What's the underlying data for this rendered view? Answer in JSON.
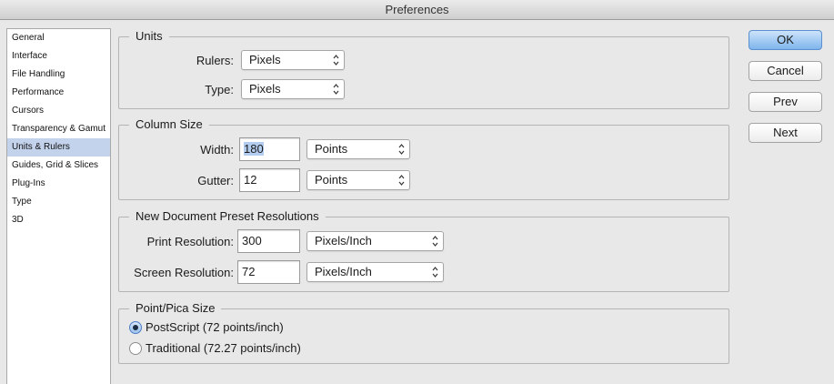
{
  "window": {
    "title": "Preferences"
  },
  "sidebar": {
    "items": [
      {
        "label": "General"
      },
      {
        "label": "Interface"
      },
      {
        "label": "File Handling"
      },
      {
        "label": "Performance"
      },
      {
        "label": "Cursors"
      },
      {
        "label": "Transparency & Gamut"
      },
      {
        "label": "Units & Rulers",
        "selected": true
      },
      {
        "label": "Guides, Grid & Slices"
      },
      {
        "label": "Plug-Ins"
      },
      {
        "label": "Type"
      },
      {
        "label": "3D"
      }
    ]
  },
  "units": {
    "legend": "Units",
    "rulers_label": "Rulers:",
    "rulers_value": "Pixels",
    "type_label": "Type:",
    "type_value": "Pixels"
  },
  "column_size": {
    "legend": "Column Size",
    "width_label": "Width:",
    "width_value": "180",
    "width_unit": "Points",
    "gutter_label": "Gutter:",
    "gutter_value": "12",
    "gutter_unit": "Points"
  },
  "resolutions": {
    "legend": "New Document Preset Resolutions",
    "print_label": "Print Resolution:",
    "print_value": "300",
    "print_unit": "Pixels/Inch",
    "screen_label": "Screen Resolution:",
    "screen_value": "72",
    "screen_unit": "Pixels/Inch"
  },
  "pica": {
    "legend": "Point/Pica Size",
    "options": [
      {
        "label": "PostScript (72 points/inch)",
        "selected": true
      },
      {
        "label": "Traditional (72.27 points/inch)",
        "selected": false
      }
    ]
  },
  "buttons": {
    "ok": "OK",
    "cancel": "Cancel",
    "prev": "Prev",
    "next": "Next"
  },
  "colors": {
    "accent": "#7fb5ec",
    "selection": "#c3d3ec",
    "background": "#e8e8e8"
  },
  "icons": {
    "select_arrow": "up-down-chevron-icon"
  }
}
